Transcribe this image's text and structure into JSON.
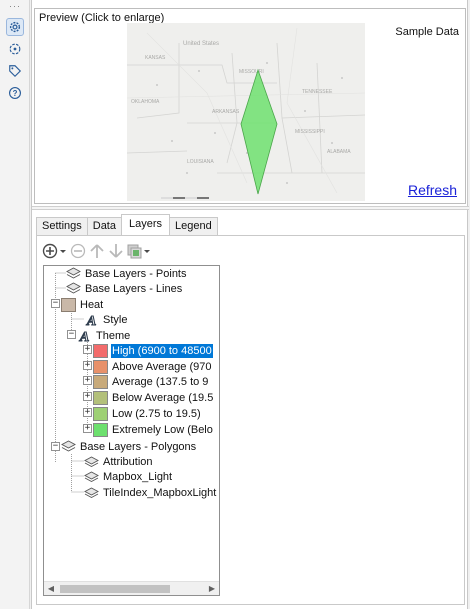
{
  "rail": {
    "items": [
      {
        "name": "settings-gear-icon",
        "active": true
      },
      {
        "name": "gps-locator-icon",
        "active": false
      },
      {
        "name": "tag-icon",
        "active": false
      },
      {
        "name": "help-icon",
        "active": false
      }
    ]
  },
  "preview": {
    "title": "Preview (Click to enlarge)",
    "sample_label": "Sample Data",
    "refresh_label": "Refresh",
    "map": {
      "country_label": "United States",
      "state_labels": [
        "OKLAHOMA",
        "ARKANSAS",
        "MISSISSIPPI",
        "ALABAMA",
        "LOUISIANA",
        "KANSAS",
        "MISSOURI",
        "TENNESSEE"
      ],
      "polygon_color": "#6fe06f"
    }
  },
  "tabs": [
    {
      "label": "Settings",
      "active": false
    },
    {
      "label": "Data",
      "active": false
    },
    {
      "label": "Layers",
      "active": true
    },
    {
      "label": "Legend",
      "active": false
    }
  ],
  "toolbar": {
    "buttons": [
      "add-layer-dropdown",
      "remove-layer",
      "move-up",
      "move-down",
      "layer-style-dropdown"
    ]
  },
  "tree": {
    "nodes": [
      {
        "label": "Base Layers - Points",
        "icon": "layers-icon"
      },
      {
        "label": "Base Layers - Lines",
        "icon": "layers-icon"
      },
      {
        "label": "Heat",
        "icon": "heat-swatch"
      },
      {
        "label": "Style",
        "icon": "style-a-icon"
      },
      {
        "label": "Theme",
        "icon": "theme-a-icon"
      },
      {
        "label": "High (6900 to 48500",
        "color": "#f26b6b",
        "selected": true
      },
      {
        "label": "Above Average (970",
        "color": "#e8916a"
      },
      {
        "label": "Average (137.5 to 9",
        "color": "#c8aa7a"
      },
      {
        "label": "Below Average (19.5",
        "color": "#b3c07a"
      },
      {
        "label": "Low (2.75 to 19.5)",
        "color": "#9ed074"
      },
      {
        "label": "Extremely Low (Belo",
        "color": "#6de06e"
      },
      {
        "label": "Base Layers - Polygons",
        "icon": "layers-icon"
      },
      {
        "label": "Attribution",
        "icon": "layer-icon"
      },
      {
        "label": "Mapbox_Light",
        "icon": "layer-icon"
      },
      {
        "label": "TileIndex_MapboxLight",
        "icon": "layer-icon"
      }
    ],
    "heat_color": "#c9b8a8"
  }
}
